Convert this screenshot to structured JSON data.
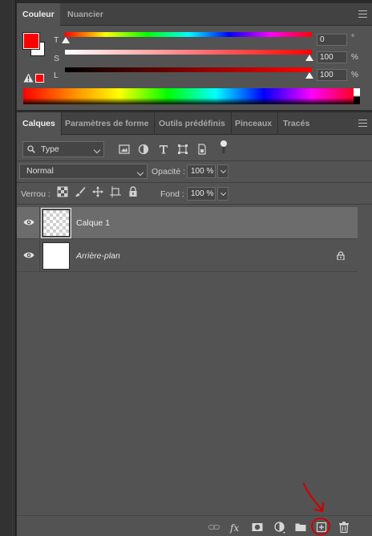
{
  "color_panel": {
    "tabs": [
      {
        "label": "Couleur",
        "active": true
      },
      {
        "label": "Nuancier",
        "active": false
      }
    ],
    "foreground_color": "#ff0000",
    "background_color": "#ffffff",
    "sliders": [
      {
        "label": "T",
        "value": "0",
        "unit": "°"
      },
      {
        "label": "S",
        "value": "100",
        "unit": "%"
      },
      {
        "label": "L",
        "value": "100",
        "unit": "%"
      }
    ]
  },
  "layers_panel": {
    "tabs": [
      {
        "label": "Calques",
        "active": true
      },
      {
        "label": "Paramètres de forme",
        "active": false
      },
      {
        "label": "Outils prédéfinis",
        "active": false
      },
      {
        "label": "Pinceaux",
        "active": false
      },
      {
        "label": "Tracés",
        "active": false
      }
    ],
    "filter_type": "Type",
    "blend_mode": "Normal",
    "opacity_label": "Opacité :",
    "opacity_value": "100 %",
    "lock_label": "Verrou :",
    "fill_label": "Fond :",
    "fill_value": "100 %",
    "layers": [
      {
        "name": "Calque 1",
        "selected": true,
        "visible": true,
        "locked": false
      },
      {
        "name": "Arrière-plan",
        "selected": false,
        "visible": true,
        "locked": true
      }
    ],
    "highlight_color": "#d10000"
  }
}
